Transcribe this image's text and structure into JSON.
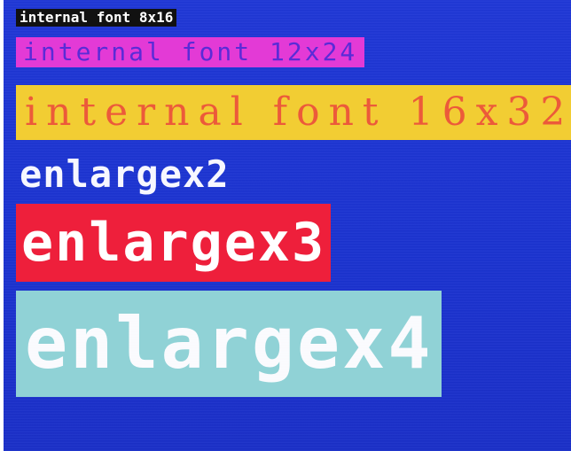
{
  "screen": {
    "lines": [
      {
        "text": "internal font 8x16"
      },
      {
        "text": "internal font 12x24"
      },
      {
        "text": "internal font 16x32"
      },
      {
        "text": "enlargex2"
      },
      {
        "text": "enlargex3"
      },
      {
        "text": "enlargex4"
      }
    ]
  },
  "colors": {
    "screen_bg": "#1f37d6",
    "l1_bg": "#111111",
    "l1_fg": "#ffffff",
    "l2_bg": "#e33ad6",
    "l2_fg": "#5a2bd7",
    "l3_bg": "#f2cd33",
    "l3_fg": "#ec5a3a",
    "l4_fg": "#f7f7ff",
    "l5_bg": "#ee1f3b",
    "l5_fg": "#ffffff",
    "l6_bg": "#93d6d7",
    "l6_fg": "#ffffff"
  }
}
